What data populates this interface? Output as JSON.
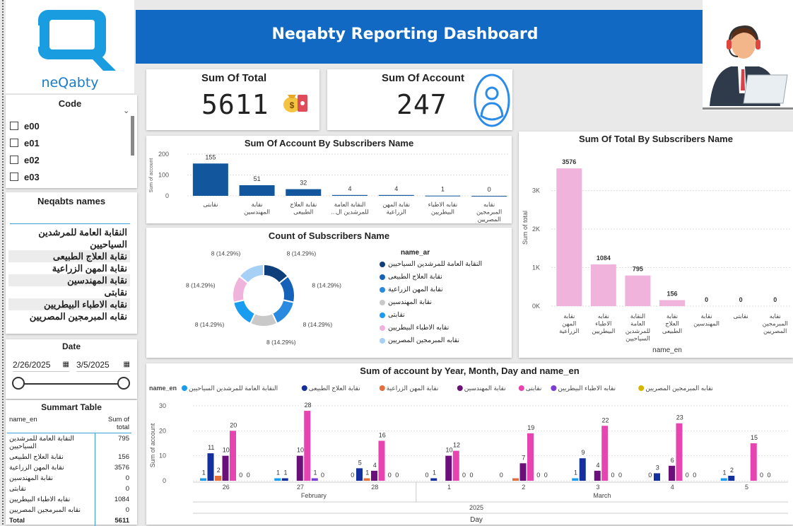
{
  "header": {
    "title": "Neqabty Reporting Dashboard",
    "logo_text": "neQabty"
  },
  "kpis": {
    "total": {
      "label": "Sum Of Total",
      "value": "5611",
      "icon": "money-bag-icon"
    },
    "account": {
      "label": "Sum Of Account",
      "value": "247",
      "icon": "person-circle-icon"
    }
  },
  "code_slicer": {
    "title": "Code",
    "items": [
      "e00",
      "e01",
      "e02",
      "e03"
    ]
  },
  "names_slicer": {
    "title": "Neqabts names",
    "items": [
      "النقابة العامة للمرشدين السياحيين",
      "نقابة العلاج الطبيعى",
      "نقابة المهن الزراعية",
      "نقابة المهندسين",
      "نقابتى",
      "نقابه الاطباء البيطريين",
      "نقابه المبرمجين المصريين"
    ]
  },
  "date_slicer": {
    "title": "Date",
    "start": "2/26/2025",
    "end": "3/5/2025",
    "range_fraction": [
      0,
      1
    ]
  },
  "summary_table": {
    "title": "Summart Table",
    "col_name": "name_en",
    "col_total": "Sum of total",
    "rows": [
      {
        "name": "النقابة العامة للمرشدين السياحيين",
        "total": "795"
      },
      {
        "name": "نقابة العلاج الطبيعى",
        "total": "156"
      },
      {
        "name": "نقابة المهن الزراعية",
        "total": "3576"
      },
      {
        "name": "نقابة المهندسين",
        "total": "0"
      },
      {
        "name": "نقابتى",
        "total": "0"
      },
      {
        "name": "نقابه الاطباء البيطريين",
        "total": "1084"
      },
      {
        "name": "نقابه المبرمجين المصريين",
        "total": "0"
      }
    ],
    "total_label": "Total",
    "total_value": "5611"
  },
  "colors": {
    "brand_blue": "#1269c4",
    "bar_dark_blue": "#12579e",
    "pink": "#f0b3dc",
    "s1": "#0e3f7a",
    "s2": "#1662b8",
    "s3": "#2a8ae0",
    "s4": "#c9c9c9",
    "s5": "#1a9cf0",
    "s6": "#f0b3dc",
    "s7": "#a6d0f5"
  },
  "chart_data": [
    {
      "type": "bar",
      "title": "Sum Of Account By Subscribers Name",
      "ylabel": "Sum of account",
      "ylim": [
        0,
        200
      ],
      "yticks": [
        "0",
        "100",
        "200"
      ],
      "categories": [
        "نقابتى",
        "نقابة المهندسين",
        "نقابة العلاج الطبيعى",
        "النقابة العامة للمرشدين ال...",
        "نقابة المهن الزراعية",
        "نقابه الاطباء البيطريين",
        "نقابه المبرمجين المصريين"
      ],
      "values": [
        155,
        51,
        32,
        4,
        4,
        1,
        0
      ]
    },
    {
      "type": "pie",
      "title": "Count of Subscribers Name",
      "legend_title": "name_ar",
      "labels": [
        "النقابة العامة للمرشدين السياحيين",
        "نقابة العلاج الطبيعى",
        "نقابة المهن الزراعية",
        "نقابة المهندسين",
        "نقابتى",
        "نقابه الاطباء البيطريين",
        "نقابه المبرمجين المصريين"
      ],
      "values": [
        8,
        8,
        8,
        8,
        8,
        8,
        8
      ],
      "slice_labels": [
        "8 (14.29%)",
        "8 (14.29%)",
        "8 (14.29%)",
        "8 (14.29%)",
        "8 (14.29%)",
        "8 (14.29%)",
        "8 (14.29%)"
      ]
    },
    {
      "type": "bar",
      "title": "Sum Of Total By Subscribers Name",
      "xlabel": "name_en",
      "ylabel": "Sum of total",
      "ylim": [
        0,
        3800
      ],
      "yticks": [
        "0K",
        "1K",
        "2K",
        "3K"
      ],
      "categories": [
        "نقابة المهن الزراعية",
        "نقابه الاطباء البيطريين",
        "النقابة العامة للمرشدين السياحيين",
        "نقابة العلاج الطبيعى",
        "نقابة المهندسين",
        "نقابتى",
        "نقابه المبرمجين المصريين"
      ],
      "values": [
        3576,
        1084,
        795,
        156,
        0,
        0,
        0
      ]
    },
    {
      "type": "bar",
      "title": "Sum of account by Year, Month, Day and name_en",
      "legend_title": "name_en",
      "xlabel": "Day",
      "ylabel": "Sum of account",
      "ylim": [
        0,
        30
      ],
      "yticks": [
        "0",
        "10",
        "20",
        "30"
      ],
      "year": "2025",
      "months": [
        {
          "name": "February",
          "days": [
            "26",
            "27",
            "28"
          ]
        },
        {
          "name": "March",
          "days": [
            "1",
            "2",
            "3",
            "4",
            "5"
          ]
        }
      ],
      "categories": [
        "26",
        "27",
        "28",
        "1",
        "2",
        "3",
        "4",
        "5"
      ],
      "series": [
        {
          "name": "النقابة العامة للمرشدين السياحيين",
          "color": "#1a9cf0",
          "values": [
            1,
            1,
            0,
            0,
            0,
            1,
            0,
            1
          ]
        },
        {
          "name": "نقابة العلاج الطبيعى",
          "color": "#142f9e",
          "values": [
            11,
            1,
            5,
            1,
            0,
            9,
            3,
            2
          ]
        },
        {
          "name": "نقابة المهن الزراعية",
          "color": "#e3703a",
          "values": [
            2,
            0,
            1,
            0,
            1,
            0,
            0,
            0
          ]
        },
        {
          "name": "نقابة المهندسين",
          "color": "#6b0f7a",
          "values": [
            10,
            10,
            4,
            10,
            7,
            4,
            6,
            0
          ]
        },
        {
          "name": "نقابتى",
          "color": "#e544b1",
          "values": [
            20,
            28,
            16,
            12,
            19,
            22,
            23,
            15
          ]
        },
        {
          "name": "نقابه الاطباء البيطريين",
          "color": "#7a3ed6",
          "values": [
            0,
            1,
            0,
            0,
            0,
            0,
            0,
            0
          ]
        },
        {
          "name": "نقابه المبرمجين المصريين",
          "color": "#d6b400",
          "values": [
            0,
            0,
            0,
            0,
            0,
            0,
            0,
            0
          ]
        }
      ],
      "point_labels": [
        [
          "1",
          "11",
          "2",
          "10",
          "20",
          "0",
          "0"
        ],
        [
          "1",
          "1",
          "",
          "10",
          "28",
          "1",
          "0"
        ],
        [
          "0",
          "5",
          "1",
          "4",
          "16",
          "0",
          "0"
        ],
        [
          "0",
          "1",
          "",
          "10",
          "12",
          "0",
          "0"
        ],
        [
          "0",
          "",
          "",
          "7",
          "19",
          "0",
          "0"
        ],
        [
          "1",
          "9",
          "",
          "4",
          "22",
          "0",
          "0"
        ],
        [
          "0",
          "3",
          "",
          "6",
          "23",
          "0",
          "0"
        ],
        [
          "1",
          "2",
          "",
          "",
          "15",
          "0",
          "0"
        ]
      ]
    }
  ]
}
